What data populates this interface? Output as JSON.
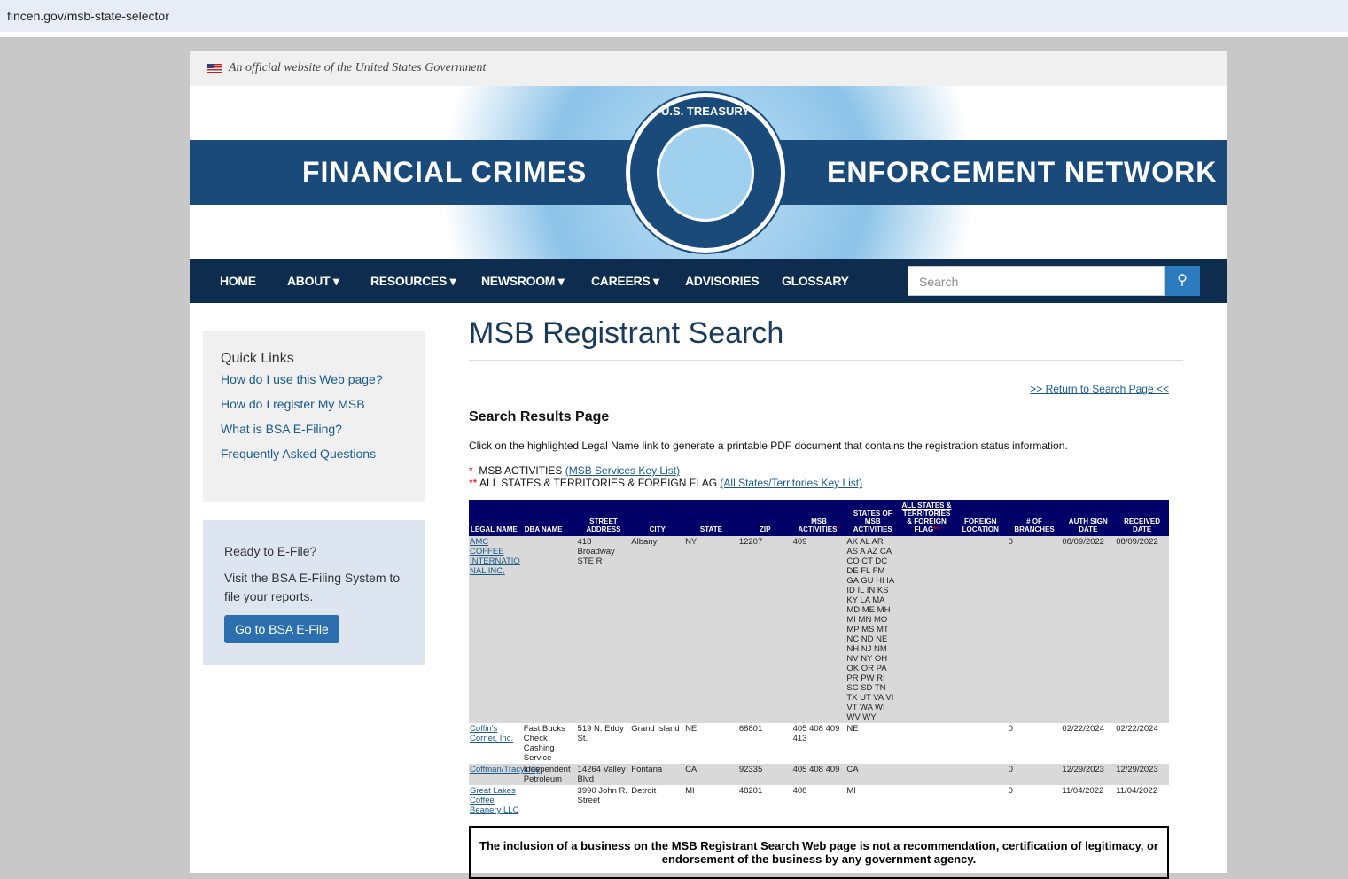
{
  "url": "fincen.gov/msb-state-selector",
  "gov_banner": "An official website of the United States Government",
  "header": {
    "left": "FINANCIAL CRIMES",
    "right": "ENFORCEMENT NETWORK",
    "seal": "U.S. TREASURY"
  },
  "nav": [
    "HOME",
    "ABOUT ▾",
    "RESOURCES ▾",
    "NEWSROOM ▾",
    "CAREERS ▾",
    "ADVISORIES",
    "GLOSSARY"
  ],
  "search": {
    "placeholder": "Search"
  },
  "quick_links": {
    "title": "Quick Links",
    "items": [
      "How do I use this Web page?",
      "How do I register My MSB",
      "What is BSA E-Filing?",
      "Frequently Asked Questions"
    ]
  },
  "efile": {
    "title": "Ready to E-File?",
    "text": "Visit the BSA E-Filing System to file your reports.",
    "button": "Go to BSA E-File"
  },
  "main": {
    "title": "MSB Registrant Search",
    "return": ">> Return to Search Page <<",
    "subtitle": "Search Results Page",
    "desc": "Click on the highlighted Legal Name link to generate a printable PDF document that contains the registration status information.",
    "key1": {
      "mark": "*",
      "text": "  MSB ACTIVITIES ",
      "link": "(MSB Services Key List)"
    },
    "key2": {
      "mark": "**",
      "text": " ALL STATES & TERRITORIES & FOREIGN FLAG ",
      "link": "(All States/Territories Key List)"
    }
  },
  "table": {
    "headers": [
      "LEGAL NAME",
      "DBA NAME",
      "STREET ADDRESS",
      "CITY",
      "STATE",
      "ZIP",
      "MSB ACTIVITIES*",
      "STATES OF MSB ACTIVITIES",
      "ALL STATES & TERRITORIES & FOREIGN FLAG**",
      "FOREIGN LOCATION",
      "# OF BRANCHES",
      "AUTH SIGN DATE",
      "RECEIVED DATE"
    ],
    "rows": [
      [
        "AMC COFFEE INTERNATIO NAL INC.",
        "",
        "418 Broadway STE R",
        "Albany",
        "NY",
        "12207",
        "409",
        "AK AL AR AS A AZ CA CO CT DC DE FL FM GA GU HI IA ID IL IN KS KY LA MA MD ME MH MI MN MO MP MS MT NC ND NE NH NJ NM NV NY OH OK OR PA PR PW RI SC SD TN TX UT VA VI VT WA WI WV WY",
        "",
        "",
        "0",
        "08/09/2022",
        "08/09/2022"
      ],
      [
        "Coffin's Corner, Inc.",
        "Fast Bucks Check Cashing Service",
        "519 N. Eddy St.",
        "Grand Island",
        "NE",
        "68801",
        "405 408 409 413",
        "NE",
        "",
        "",
        "0",
        "02/22/2024",
        "02/22/2024"
      ],
      [
        "Coffman/Tracy/Jay",
        "Independent Petroleum",
        "14264 Valley Blvd",
        "Fontana",
        "CA",
        "92335",
        "405 408 409",
        "CA",
        "",
        "",
        "0",
        "12/29/2023",
        "12/29/2023"
      ],
      [
        "Great Lakes Coffee Beanery LLC",
        "",
        "3990 John R. Street",
        "Detroit",
        "MI",
        "48201",
        "408",
        "MI",
        "",
        "",
        "0",
        "11/04/2022",
        "11/04/2022"
      ]
    ]
  },
  "disclaimer": "The inclusion of a business on the MSB Registrant Search Web page is not a recommendation, certification of legitimacy, or endorsement of the business by any government agency."
}
